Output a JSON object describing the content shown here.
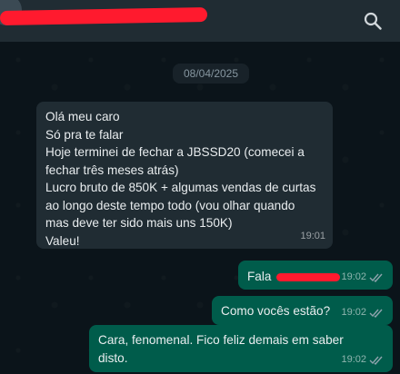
{
  "header": {
    "search_icon": "search-icon"
  },
  "chat": {
    "date": "08/04/2025",
    "messages": [
      {
        "direction": "incoming",
        "lines": [
          "Olá meu caro",
          "Só pra te falar",
          "Hoje terminei de fechar a JBSSD20 (comecei a",
          "fechar três meses atrás)",
          "Lucro bruto de 850K + algumas vendas de curtas",
          "ao longo deste tempo todo (vou olhar quando",
          "mas deve ter sido mais uns 150K)",
          "Valeu!"
        ],
        "time": "19:01"
      },
      {
        "direction": "outgoing",
        "text": "Fala",
        "time": "19:02"
      },
      {
        "direction": "outgoing",
        "text": "Como vocês estão?",
        "time": "19:02"
      },
      {
        "direction": "outgoing",
        "lines": [
          "Cara, fenomenal. Fico feliz demais em saber",
          "disto."
        ],
        "time": "19:02"
      }
    ]
  },
  "colors": {
    "background": "#0b141a",
    "header": "#202c33",
    "incoming_bubble": "#202c33",
    "outgoing_bubble": "#005c4b",
    "redaction": "#ff1a2e"
  }
}
